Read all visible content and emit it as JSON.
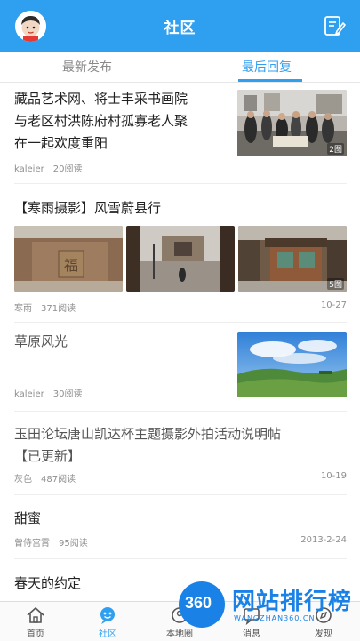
{
  "header": {
    "title": "社区",
    "avatar_icon": "user-avatar-icon",
    "compose_icon": "edit-post-icon",
    "bg_color": "#2f9ff0"
  },
  "tabs": [
    {
      "label": "最新发布",
      "active": false
    },
    {
      "label": "最后回复",
      "active": true
    }
  ],
  "posts": [
    {
      "title_line1": "藏品艺术网、将士丰采书画院",
      "title_line2": "与老区村洪陈府村孤寡老人聚",
      "title_line3": "在一起欢度重阳",
      "author": "kaleier",
      "views": "20阅读",
      "img_count": "2图"
    },
    {
      "title": "【寒雨摄影】风雪蔚县行",
      "author": "寒雨",
      "views": "371阅读",
      "date": "10-27",
      "img_count": "5图"
    },
    {
      "title": "草原风光",
      "author": "kaleier",
      "views": "30阅读"
    },
    {
      "title_line1": "玉田论坛唐山凯达杯主题摄影外拍活动说明帖",
      "title_line2": "【已更新】",
      "author": "灰色",
      "views": "487阅读",
      "date": "10-19"
    },
    {
      "title": "甜蜜",
      "author": "曾侍宫霄",
      "views": "95阅读",
      "date": "2013-2-24"
    },
    {
      "title": "春天的约定"
    }
  ],
  "bottom_nav": [
    {
      "label": "首页",
      "icon": "home-icon",
      "active": false
    },
    {
      "label": "社区",
      "icon": "community-icon",
      "active": true
    },
    {
      "label": "本地圈",
      "icon": "local-circle-icon",
      "active": false
    },
    {
      "label": "消息",
      "icon": "message-icon",
      "active": false
    },
    {
      "label": "发现",
      "icon": "discover-icon",
      "active": false
    }
  ],
  "watermark": {
    "logo_text": "360",
    "title": "网站排行榜",
    "url": "WANGZHAN360.CN"
  }
}
